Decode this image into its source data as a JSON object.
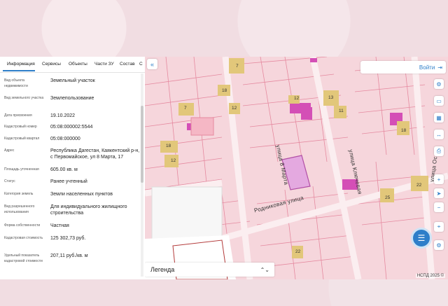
{
  "panel": {
    "tabs": [
      "Информация",
      "Сервисы",
      "Объекты",
      "Части ЗУ",
      "Состав",
      "С"
    ],
    "active_tab": 0,
    "rows": [
      {
        "label": "Вид объекта недвижимости",
        "value": "Земельный участок"
      },
      {
        "label": "Вид земельного участка",
        "value": "Землепользование"
      },
      {
        "label": "Дата присвоения",
        "value": "19.10.2022"
      },
      {
        "label": "Кадастровый номер",
        "value": "05:08:000002:5544"
      },
      {
        "label": "Кадастровый квартал",
        "value": "05:08:000000"
      },
      {
        "label": "Адрес",
        "value": "Республика Дагестан, Каякентский р-н, с Первомайское, ул 8 Марта, 17"
      },
      {
        "label": "Площадь уточненная",
        "value": "605.00 кв. м"
      },
      {
        "label": "Статус",
        "value": "Ранее учтенный"
      },
      {
        "label": "Категория земель",
        "value": "Земли населенных пунктов"
      },
      {
        "label": "Вид разрешенного использования",
        "value": "Для индивидуального жилищного строительства"
      },
      {
        "label": "Форма собственности",
        "value": "Частная"
      },
      {
        "label": "Кадастровая стоимость",
        "value": "125 302,73 руб."
      },
      {
        "label": "Удельный показатель кадастровой стоимости",
        "value": "207,11 руб./кв. м"
      }
    ]
  },
  "map": {
    "login_label": "Войти",
    "legend_label": "Легенда",
    "attribution": "НСПД 2025 ©",
    "streets": {
      "s1": "улица 8 Марта",
      "s2": "Родниковая улица",
      "s3": "улица Ключевая",
      "s4": "улица Ос"
    },
    "lot_numbers": [
      "7",
      "18",
      "12",
      "7",
      "12",
      "18",
      "12",
      "13",
      "11",
      "18",
      "22",
      "25",
      "22"
    ],
    "colors": {
      "map_bg": "#f6d6dc",
      "parcel_line": "#e58aa0",
      "highlight": "#c77bd6",
      "magenta": "#d44fb6",
      "building": "#e2c77a",
      "accent": "#2e7ec9"
    }
  }
}
